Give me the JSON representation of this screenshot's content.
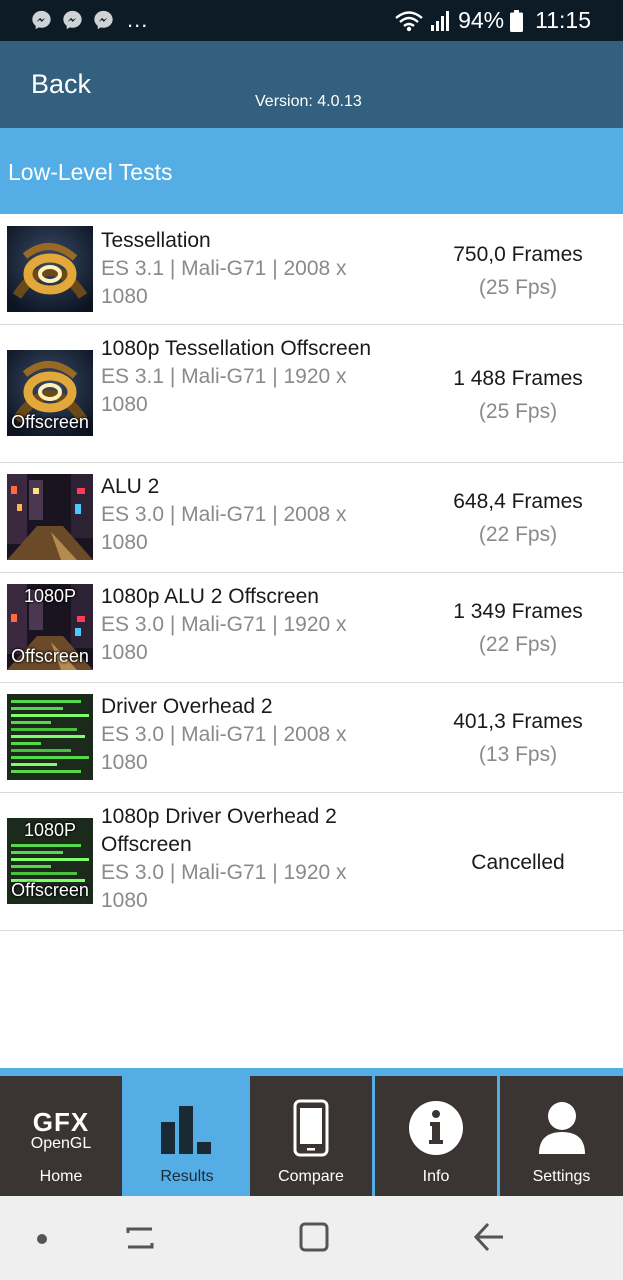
{
  "status_bar": {
    "left_icons": [
      "messenger-icon",
      "messenger-icon",
      "messenger-icon"
    ],
    "dots": "...",
    "battery": "94%",
    "time": "11:15"
  },
  "header": {
    "back_label": "Back",
    "version": "Version: 4.0.13"
  },
  "section": {
    "title": "Low-Level Tests"
  },
  "tests": [
    {
      "name": "Tessellation",
      "detail": "ES 3.1 | Mali-G71 | 2008 x 1080",
      "frames": "750,0 Frames",
      "fps": "(25 Fps)",
      "thumb_top": "",
      "thumb_bottom": ""
    },
    {
      "name": "1080p Tessellation Offscreen",
      "detail": "ES 3.1 | Mali-G71 | 1920 x 1080",
      "frames": "1 488 Frames",
      "fps": "(25 Fps)",
      "thumb_top": "",
      "thumb_bottom": "Offscreen"
    },
    {
      "name": "ALU 2",
      "detail": "ES 3.0 | Mali-G71 | 2008 x 1080",
      "frames": "648,4 Frames",
      "fps": "(22 Fps)",
      "thumb_top": "",
      "thumb_bottom": ""
    },
    {
      "name": "1080p ALU 2 Offscreen",
      "detail": "ES 3.0 | Mali-G71 | 1920 x 1080",
      "frames": "1 349 Frames",
      "fps": "(22 Fps)",
      "thumb_top": "1080P",
      "thumb_bottom": "Offscreen"
    },
    {
      "name": "Driver Overhead 2",
      "detail": "ES 3.0 | Mali-G71 | 2008 x 1080",
      "frames": "401,3 Frames",
      "fps": "(13 Fps)",
      "thumb_top": "",
      "thumb_bottom": ""
    },
    {
      "name": "1080p Driver Overhead 2 Offscreen",
      "detail": "ES 3.0 | Mali-G71 | 1920 x 1080",
      "frames": "Cancelled",
      "fps": "",
      "thumb_top": "1080P",
      "thumb_bottom": "Offscreen"
    }
  ],
  "tabs": [
    {
      "label": "Home",
      "icon": "gfx-opengl-logo",
      "logo_main": "GFX",
      "logo_sub": "OpenGL",
      "active": false
    },
    {
      "label": "Results",
      "icon": "bar-chart-icon",
      "active": true
    },
    {
      "label": "Compare",
      "icon": "phone-icon",
      "active": false
    },
    {
      "label": "Info",
      "icon": "info-icon",
      "active": false
    },
    {
      "label": "Settings",
      "icon": "user-icon",
      "active": false
    }
  ],
  "nav": [
    "dot-icon",
    "recents-icon",
    "home-square-icon",
    "back-arrow-icon"
  ],
  "colors": {
    "status_bar": "#0d1b26",
    "app_bar": "#33607f",
    "section_header": "#55ade6",
    "tab_bar": "#3a3533",
    "tab_active": "#55ade6"
  }
}
